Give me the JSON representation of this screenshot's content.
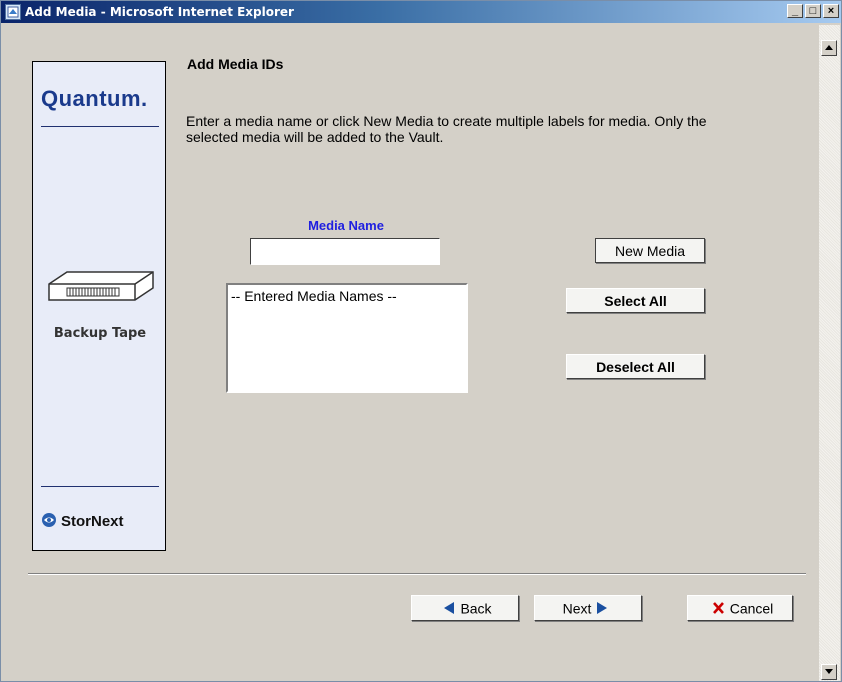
{
  "window": {
    "title": "Add Media - Microsoft Internet Explorer"
  },
  "sidebar": {
    "brand": "Quantum.",
    "image_caption": "Backup Tape",
    "product": "StorNext"
  },
  "main": {
    "heading": "Add Media IDs",
    "description": "Enter a media name or click New Media to create multiple labels for media. Only the selected media will be added to the Vault.",
    "media_name_label": "Media Name",
    "media_name_value": "",
    "list_items": [
      "-- Entered Media Names --"
    ]
  },
  "buttons": {
    "new_media": "New Media",
    "select_all": "Select All",
    "deselect_all": "Deselect All",
    "back": "Back",
    "next": "Next",
    "cancel": "Cancel"
  },
  "colors": {
    "titlebar_start": "#0a246a",
    "label_blue": "#1f1fe0",
    "brand_blue": "#1a3a8c",
    "cancel_red": "#cc0000",
    "arrow_blue": "#1a4fa0"
  }
}
